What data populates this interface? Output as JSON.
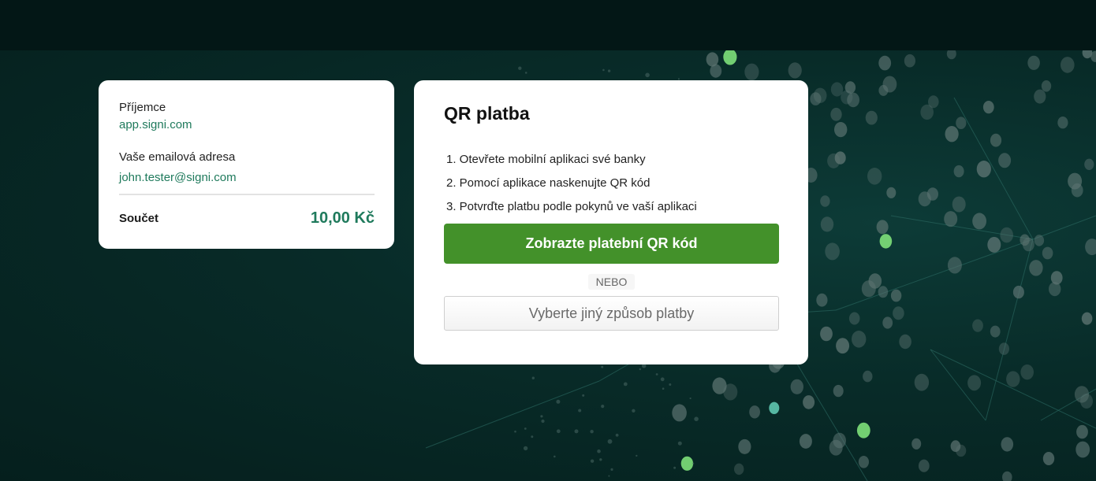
{
  "summary": {
    "recipient_label": "Příjemce",
    "recipient_value": "app.signi.com",
    "email_label": "Vaše emailová adresa",
    "email_value": "john.tester@signi.com",
    "total_label": "Součet",
    "total_amount": "10,00 Kč"
  },
  "qr_payment": {
    "title": "QR platba",
    "steps": [
      "1. Otevřete mobilní aplikaci své banky",
      "2. Pomocí aplikace naskenujte QR kód",
      "3. Potvrďte platbu podle pokynů ve vaší aplikaci"
    ],
    "show_qr_button": "Zobrazte platební QR kód",
    "or_text": "NEBO",
    "other_method_button": "Vyberte jiný způsob platby"
  },
  "colors": {
    "accent_green": "#43912a",
    "link_green": "#1f7a5c",
    "background": "#062623",
    "topbar": "#031716"
  }
}
